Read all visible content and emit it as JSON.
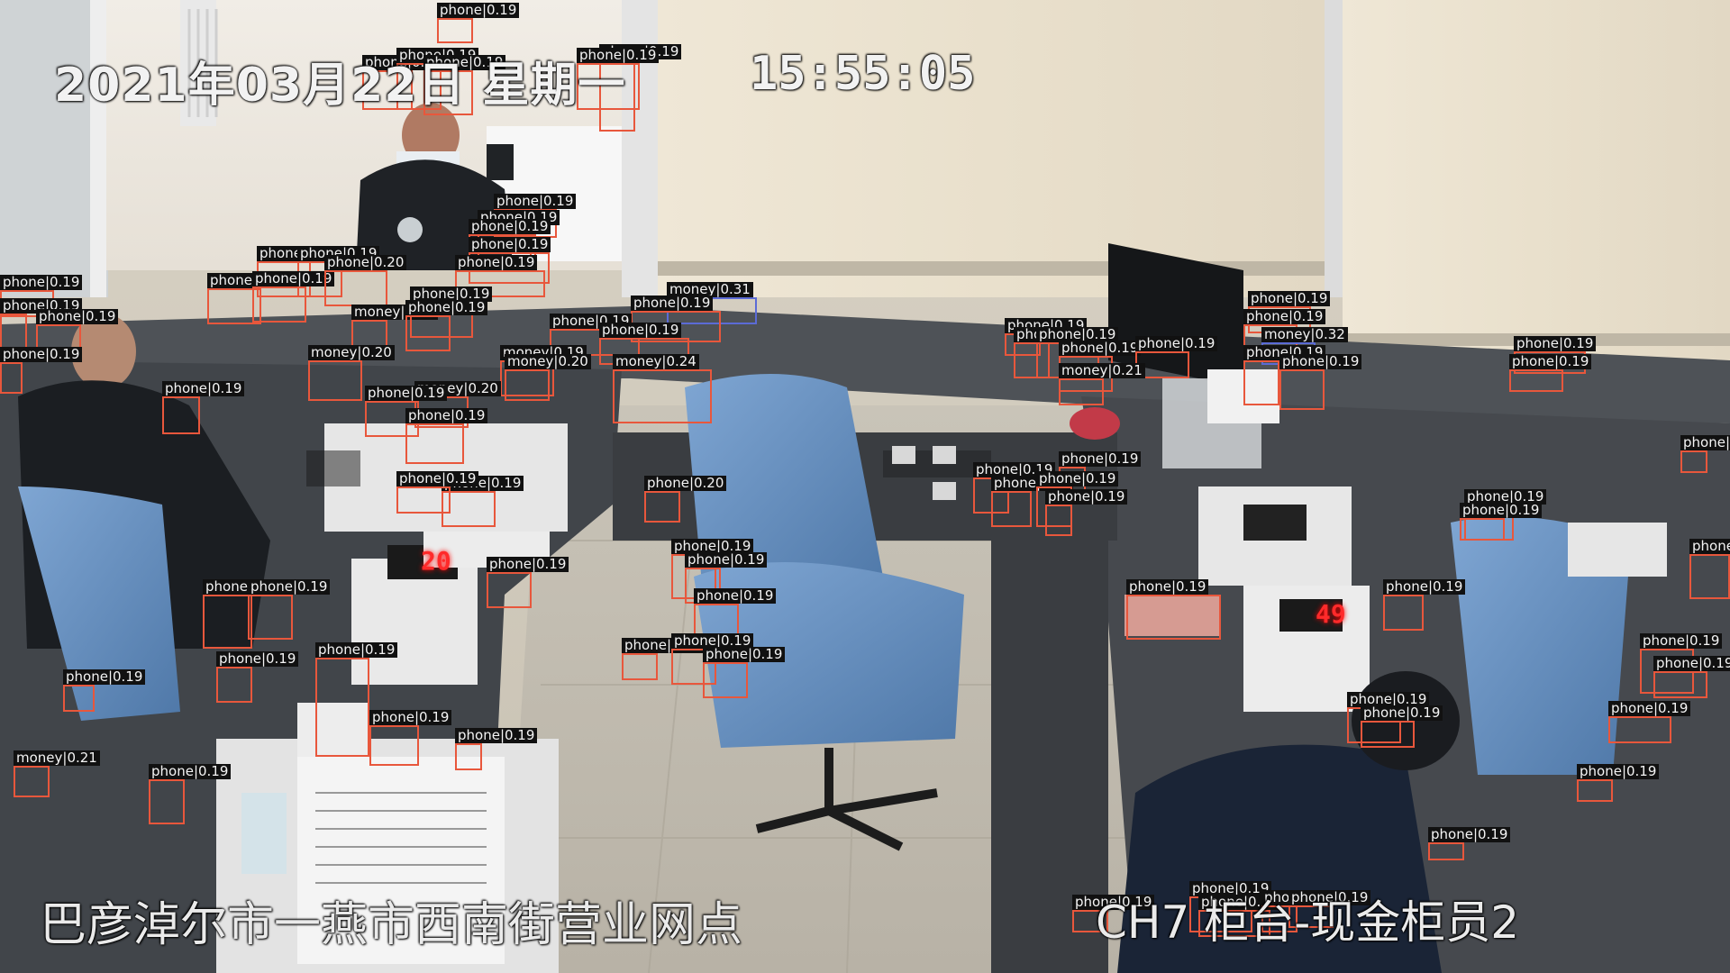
{
  "osd": {
    "date_weekday": "2021年03月22日 星期一",
    "time": "15:55:05",
    "location": "巴彦淖尔市一燕市西南街营业网点",
    "channel": "CH7 柜台-现金柜员2"
  },
  "displays": {
    "counter_left": "20",
    "counter_right": "49"
  },
  "detections": [
    {
      "label": "phone",
      "score": "0.19"
    },
    {
      "label": "phone",
      "score": "0.19"
    },
    {
      "label": "phone",
      "score": "0.19"
    },
    {
      "label": "phone",
      "score": "0.19"
    },
    {
      "label": "phone",
      "score": "0.19"
    },
    {
      "label": "phone",
      "score": "0.19"
    },
    {
      "label": "phone",
      "score": "0.19"
    },
    {
      "label": "phone",
      "score": "0.19"
    },
    {
      "label": "phone",
      "score": "0.19"
    },
    {
      "label": "phone",
      "score": "0.19"
    },
    {
      "label": "phone",
      "score": "0.19"
    },
    {
      "label": "phone",
      "score": "0.19"
    },
    {
      "label": "phone",
      "score": "0.19"
    },
    {
      "label": "phone",
      "score": "0.19"
    },
    {
      "label": "phone",
      "score": "0.19"
    },
    {
      "label": "phone",
      "score": "0.20"
    },
    {
      "label": "phone",
      "score": "0.19"
    },
    {
      "label": "phone",
      "score": "0.19"
    },
    {
      "label": "phone",
      "score": "0.19"
    },
    {
      "label": "phone",
      "score": "0.19"
    },
    {
      "label": "money",
      "score": "0.27"
    },
    {
      "label": "phone",
      "score": "0.19"
    },
    {
      "label": "phone",
      "score": "0.19"
    },
    {
      "label": "money",
      "score": "0.31"
    },
    {
      "label": "phone",
      "score": "0.19"
    },
    {
      "label": "phone",
      "score": "0.19"
    },
    {
      "label": "phone",
      "score": "0.19"
    },
    {
      "label": "money",
      "score": "0.19"
    },
    {
      "label": "money",
      "score": "0.20"
    },
    {
      "label": "money",
      "score": "0.24"
    },
    {
      "label": "money",
      "score": "0.20"
    },
    {
      "label": "phone",
      "score": "0.19"
    },
    {
      "label": "money",
      "score": "0.20"
    },
    {
      "label": "phone",
      "score": "0.19"
    },
    {
      "label": "phone",
      "score": "0.19"
    },
    {
      "label": "phone",
      "score": "0.19"
    },
    {
      "label": "phone",
      "score": "0.19"
    },
    {
      "label": "phone",
      "score": "0.20"
    },
    {
      "label": "phone",
      "score": "0.19"
    },
    {
      "label": "phone",
      "score": "0.19"
    },
    {
      "label": "phone",
      "score": "0.19"
    },
    {
      "label": "phone",
      "score": "0.19"
    },
    {
      "label": "phone",
      "score": "0.19"
    },
    {
      "label": "phone",
      "score": "0.19"
    },
    {
      "label": "phone",
      "score": "0.19"
    },
    {
      "label": "phone",
      "score": "0.19"
    },
    {
      "label": "phone",
      "score": "0.19"
    },
    {
      "label": "phone",
      "score": "0.19"
    },
    {
      "label": "phone",
      "score": "0.19"
    },
    {
      "label": "phone",
      "score": "0.19"
    },
    {
      "label": "money",
      "score": "0.21"
    },
    {
      "label": "phone",
      "score": "0.19"
    },
    {
      "label": "phone",
      "score": "0.19"
    },
    {
      "label": "phone",
      "score": "0.19"
    },
    {
      "label": "phone",
      "score": "0.19"
    },
    {
      "label": "phone",
      "score": "0.19"
    },
    {
      "label": "phone",
      "score": "0.19"
    },
    {
      "label": "phone",
      "score": "0.19"
    },
    {
      "label": "phone",
      "score": "0.19"
    },
    {
      "label": "money",
      "score": "0.21"
    },
    {
      "label": "phone",
      "score": "0.19"
    },
    {
      "label": "phone",
      "score": "0.19"
    },
    {
      "label": "phone",
      "score": "0.19"
    },
    {
      "label": "phone",
      "score": "0.19"
    },
    {
      "label": "phone",
      "score": "0.19"
    },
    {
      "label": "phone",
      "score": "0.19"
    },
    {
      "label": "phone",
      "score": "0.19"
    },
    {
      "label": "phone",
      "score": "0.19"
    },
    {
      "label": "money",
      "score": "0.32"
    },
    {
      "label": "phone",
      "score": "0.19"
    },
    {
      "label": "phone",
      "score": "0.19"
    },
    {
      "label": "phone",
      "score": "0.19"
    },
    {
      "label": "phone",
      "score": "0.19"
    },
    {
      "label": "phone",
      "score": "0.19"
    },
    {
      "label": "phone",
      "score": "0.19"
    },
    {
      "label": "phone",
      "score": "0.19"
    },
    {
      "label": "phone",
      "score": "0.19"
    },
    {
      "label": "phone",
      "score": "0.19"
    },
    {
      "label": "phone",
      "score": "0.19"
    },
    {
      "label": "phone",
      "score": "0.19"
    },
    {
      "label": "phone",
      "score": "0.19"
    },
    {
      "label": "phone",
      "score": "0.19"
    },
    {
      "label": "phone",
      "score": "0.19"
    },
    {
      "label": "phone",
      "score": "0.19"
    },
    {
      "label": "phone",
      "score": "0.19"
    },
    {
      "label": "phone",
      "score": "0.19"
    },
    {
      "label": "phone",
      "score": "0.19"
    },
    {
      "label": "phone",
      "score": "0.19"
    },
    {
      "label": "phone",
      "score": "0.19"
    },
    {
      "label": "phone",
      "score": "0.19"
    }
  ]
}
